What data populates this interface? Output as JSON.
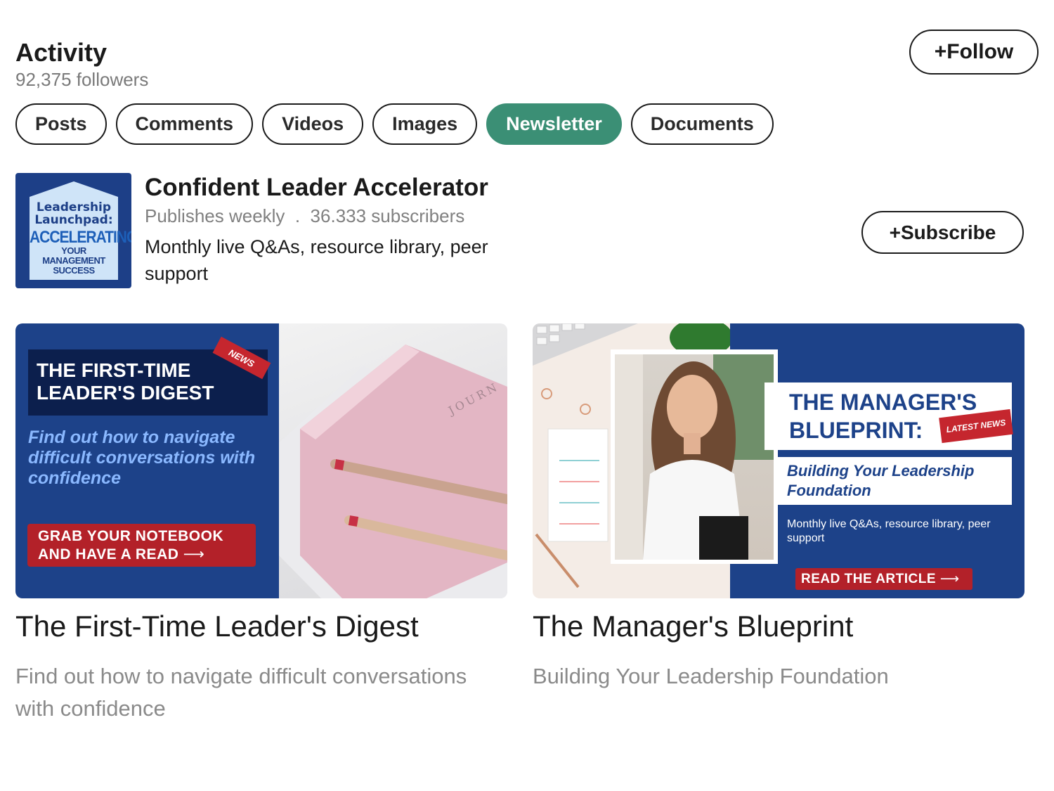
{
  "header": {
    "title": "Activity",
    "followers": "92,375 followers",
    "follow_label": "+Follow"
  },
  "tabs": [
    {
      "label": "Posts",
      "active": false
    },
    {
      "label": "Comments",
      "active": false
    },
    {
      "label": "Videos",
      "active": false
    },
    {
      "label": "Images",
      "active": false
    },
    {
      "label": "Newsletter",
      "active": true
    },
    {
      "label": "Documents",
      "active": false
    }
  ],
  "newsletter": {
    "logo": {
      "line1": "Leadership",
      "line2": "Launchpad:",
      "line3": "ACCELERATING",
      "line4": "YOUR MANAGEMENT",
      "line5": "SUCCESS"
    },
    "name": "Confident Leader Accelerator",
    "meta": "Publishes weekly  .  36.333 subscribers",
    "description": "Monthly live Q&As, resource library, peer support",
    "subscribe_label": "+Subscribe"
  },
  "articles": [
    {
      "image": {
        "box_title": "THE FIRST-TIME LEADER'S DIGEST",
        "badge": "NEWS",
        "tagline": "Find out how to navigate difficult conversations with confidence",
        "cta_line1": "GRAB YOUR NOTEBOOK",
        "cta_line2": "AND HAVE A READ",
        "notebook_text": "JOURN"
      },
      "title": "The First-Time Leader's Digest",
      "subtitle": "Find out how to navigate difficult conversations with confidence"
    },
    {
      "image": {
        "title_line1": "THE MANAGER'S",
        "title_line2": "BLUEPRINT:",
        "badge": "LATEST NEWS",
        "subtitle": "Building Your Leadership Foundation",
        "small_text": "Monthly live Q&As, resource library, peer support",
        "cta": "READ THE ARTICLE"
      },
      "title": "The Manager's Blueprint",
      "subtitle": "Building Your Leadership Foundation"
    }
  ],
  "colors": {
    "accent_green": "#3b8f75",
    "brand_blue": "#1d4289",
    "navy": "#0c1f4d",
    "cta_red": "#b32129"
  }
}
